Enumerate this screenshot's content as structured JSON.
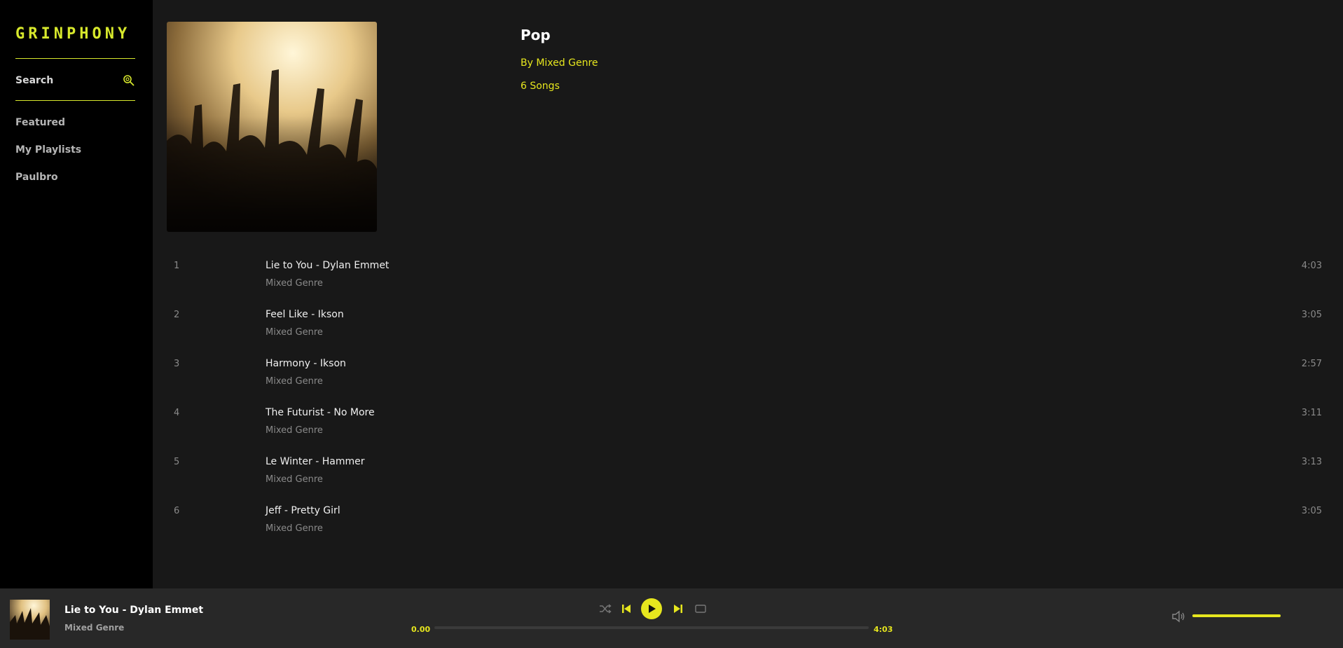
{
  "sidebar": {
    "logo": "GRINPHONY",
    "search_label": "Search",
    "nav": [
      {
        "label": "Featured"
      },
      {
        "label": "My Playlists"
      },
      {
        "label": "Paulbro"
      }
    ]
  },
  "playlist": {
    "title": "Pop",
    "owner": "By Mixed Genre",
    "count": "6 Songs",
    "cover_icon": "concert-crowd-image"
  },
  "tracks": [
    {
      "num": "1",
      "title": "Lie to You - Dylan Emmet",
      "artist": "Mixed Genre",
      "duration": "4:03"
    },
    {
      "num": "2",
      "title": "Feel Like - Ikson",
      "artist": "Mixed Genre",
      "duration": "3:05"
    },
    {
      "num": "3",
      "title": "Harmony - Ikson",
      "artist": "Mixed Genre",
      "duration": "2:57"
    },
    {
      "num": "4",
      "title": "The Futurist - No More",
      "artist": "Mixed Genre",
      "duration": "3:11"
    },
    {
      "num": "5",
      "title": "Le Winter - Hammer",
      "artist": "Mixed Genre",
      "duration": "3:13"
    },
    {
      "num": "6",
      "title": "Jeff - Pretty Girl",
      "artist": "Mixed Genre",
      "duration": "3:05"
    }
  ],
  "player": {
    "title": "Lie to You - Dylan Emmet",
    "artist": "Mixed Genre",
    "current_time": "0.00",
    "total_time": "4:03",
    "progress_fraction": 0,
    "volume_fraction": 1,
    "icons": [
      "shuffle-icon",
      "previous-icon",
      "play-icon",
      "next-icon",
      "repeat-icon",
      "volume-icon"
    ]
  },
  "colors": {
    "accent": "#e6e61e",
    "sidebar_bg": "#000000",
    "main_bg": "#181818",
    "player_bg": "#282828"
  }
}
